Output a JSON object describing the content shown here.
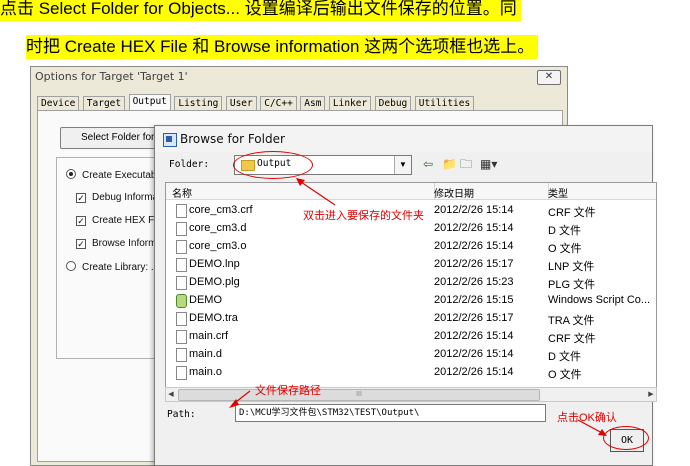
{
  "instruction": {
    "line1": "点击 Select Folder for Objects...         设置编译后输出文件保存的位置。同",
    "line2": "时把 Create HEX File 和 Browse information 这两个选项框也选上。"
  },
  "options_window": {
    "title": "Options for Target 'Target 1'",
    "close": "✕",
    "tabs": [
      "Device",
      "Target",
      "Output",
      "Listing",
      "User",
      "C/C++",
      "Asm",
      "Linker",
      "Debug",
      "Utilities"
    ],
    "select_folder_btn": "Select Folder for Ob",
    "create_executable": "Create Executable",
    "debug_info": "Debug Informati",
    "create_hex": "Create HEX File",
    "browse_info": "Browse Informat",
    "create_library": "Create Library: ..\\"
  },
  "dialog": {
    "title": "Browse for Folder",
    "folder_label": "Folder:",
    "folder_value": "Output",
    "columns": [
      "名称",
      "修改日期",
      "类型"
    ],
    "files": [
      {
        "name": "core_cm3.crf",
        "date": "2012/2/26 15:14",
        "type": "CRF 文件",
        "icon": "file"
      },
      {
        "name": "core_cm3.d",
        "date": "2012/2/26 15:14",
        "type": "D 文件",
        "icon": "file"
      },
      {
        "name": "core_cm3.o",
        "date": "2012/2/26 15:14",
        "type": "O 文件",
        "icon": "file"
      },
      {
        "name": "DEMO.lnp",
        "date": "2012/2/26 15:17",
        "type": "LNP 文件",
        "icon": "file"
      },
      {
        "name": "DEMO.plg",
        "date": "2012/2/26 15:23",
        "type": "PLG 文件",
        "icon": "file"
      },
      {
        "name": "DEMO",
        "date": "2012/2/26 15:15",
        "type": "Windows Script Co...",
        "icon": "script"
      },
      {
        "name": "DEMO.tra",
        "date": "2012/2/26 15:17",
        "type": "TRA 文件",
        "icon": "file"
      },
      {
        "name": "main.crf",
        "date": "2012/2/26 15:14",
        "type": "CRF 文件",
        "icon": "file"
      },
      {
        "name": "main.d",
        "date": "2012/2/26 15:14",
        "type": "D 文件",
        "icon": "file"
      },
      {
        "name": "main.o",
        "date": "2012/2/26 15:14",
        "type": "O 文件",
        "icon": "file"
      }
    ],
    "path_label": "Path:",
    "path_value": "D:\\MCU学习文件包\\STM32\\TEST\\Output\\",
    "ok_label": "OK",
    "scroll_thumb": "III"
  },
  "annotations": {
    "double_click": "双击进入要保存的文件夹",
    "save_path": "文件保存路径",
    "click_ok": "点击OK确认",
    "color": "#e00000"
  }
}
